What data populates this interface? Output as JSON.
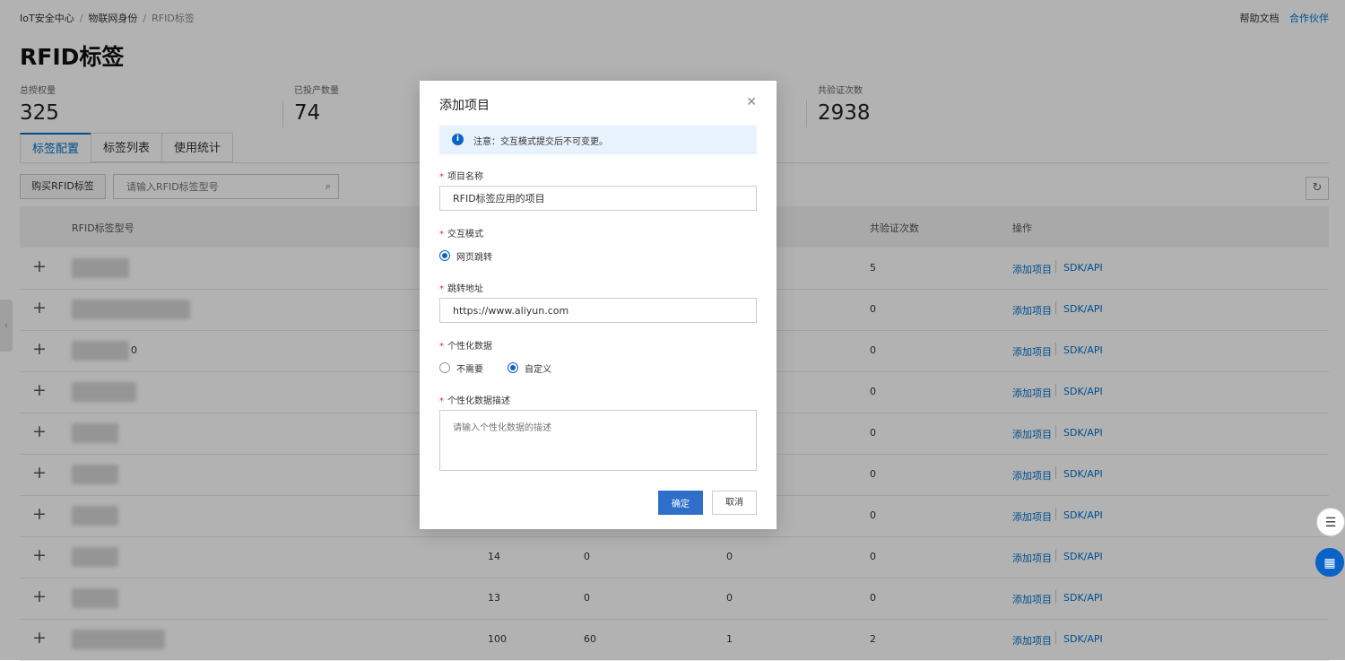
{
  "breadcrumb": [
    "IoT安全中心",
    "物联网身份",
    "RFID标签"
  ],
  "header": {
    "help": "帮助文档",
    "partner": "合作伙伴"
  },
  "page_title": "RFID标签",
  "stats": [
    {
      "label": "总授权量",
      "value": "325"
    },
    {
      "label": "已投产数量",
      "value": "74"
    },
    {
      "label": "共验证次数",
      "value": "2938"
    }
  ],
  "tabs": [
    "标签配置",
    "标签列表",
    "使用统计"
  ],
  "toolbar": {
    "buy_label": "购买RFID标签",
    "search_placeholder": "请输入RFID标签型号"
  },
  "table": {
    "headers": {
      "model": "RFID标签型号",
      "verify": "共验证次数",
      "ops": "操作"
    },
    "op_add": "添加项目",
    "op_sdk": "SDK/API",
    "rows": [
      {
        "suffix": "",
        "c1": "",
        "c2": "",
        "c3": "",
        "verify": "5"
      },
      {
        "suffix": "",
        "c1": "",
        "c2": "",
        "c3": "",
        "verify": "0"
      },
      {
        "suffix": "0",
        "c1": "",
        "c2": "",
        "c3": "",
        "verify": "0"
      },
      {
        "suffix": "",
        "c1": "",
        "c2": "",
        "c3": "",
        "verify": "0"
      },
      {
        "suffix": "",
        "c1": "",
        "c2": "",
        "c3": "",
        "verify": "0"
      },
      {
        "suffix": "",
        "c1": "",
        "c2": "",
        "c3": "",
        "verify": "0"
      },
      {
        "suffix": "",
        "c1": "",
        "c2": "",
        "c3": "",
        "verify": "0"
      },
      {
        "suffix": "",
        "c1": "14",
        "c2": "0",
        "c3": "0",
        "verify": "0"
      },
      {
        "suffix": "",
        "c1": "13",
        "c2": "0",
        "c3": "0",
        "verify": "0"
      },
      {
        "suffix": "",
        "c1": "100",
        "c2": "60",
        "c3": "1",
        "verify": "2"
      }
    ]
  },
  "modal": {
    "title": "添加项目",
    "notice": "注意：交互模式提交后不可变更。",
    "project_name_label": "项目名称",
    "project_name_value": "RFID标签应用的项目",
    "interaction_label": "交互模式",
    "interaction_option": "网页跳转",
    "redirect_label": "跳转地址",
    "redirect_value": "https://www.aliyun.com",
    "personal_label": "个性化数据",
    "personal_options": [
      "不需要",
      "自定义"
    ],
    "personal_selected": "自定义",
    "desc_label": "个性化数据描述",
    "desc_placeholder": "请输入个性化数据的描述",
    "ok_label": "确定",
    "cancel_label": "取消"
  },
  "icons": {
    "close": "close-icon",
    "info": "info-icon",
    "search": "search-icon",
    "refresh": "refresh-icon",
    "chat": "chat-icon",
    "apps": "apps-icon"
  },
  "colors": {
    "accent": "#0a63c7",
    "link": "#0070cc",
    "required": "#d93026",
    "notice_bg": "#e8f2fc"
  }
}
